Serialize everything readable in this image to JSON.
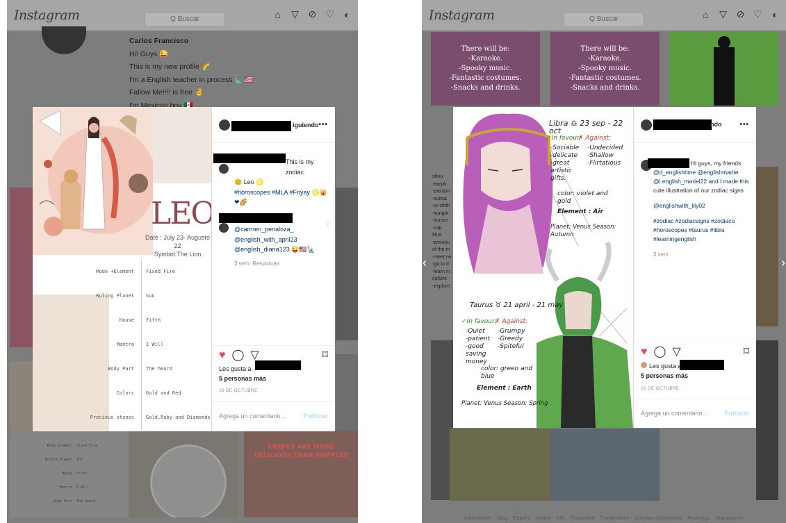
{
  "left": {
    "app": {
      "logo": "Instagram",
      "search_placeholder": "Q Buscar"
    },
    "profile": {
      "name": "Carlos Francisco",
      "bio": [
        "Hi! Guys 😜",
        "This is my new profile 🌈",
        "I'm a English teacher in process 🗽🇺🇸",
        "Fallow Me!!!! is free ✌",
        "I'm Mexican boy 🇲🇽"
      ]
    },
    "image": {
      "title": "LEO",
      "dates": "Date : July 23- Augusto 22",
      "symbol": "Symbol:The Lion",
      "table": [
        {
          "k": "Mode +Element",
          "v": "Fixed Fire"
        },
        {
          "k": "Ruling Planet",
          "v": "Sun"
        },
        {
          "k": "Hause",
          "v": "Fifth"
        },
        {
          "k": "Mantra",
          "v": "I Will"
        },
        {
          "k": "Body Part",
          "v": "The heard"
        },
        {
          "k": "Colors",
          "v": "Gold and Red"
        },
        {
          "k": "Precious stones",
          "v": "Gold,Ruby and Diamonds"
        }
      ]
    },
    "post": {
      "header_following": "iguiendo",
      "caption_tail": "This is my zodiac",
      "caption_line2": "😊 Leo ♌",
      "caption_tags": "#horoscopes #MLA #Friyay ♌🙀❤🌈",
      "caption_time": "3 sem",
      "comment_mentions": [
        "@carmen_penaloza_",
        "@english_with_april23",
        "@english_diana123 😜🇺🇸🗽"
      ],
      "comment_time": "3 sem",
      "reply_label": "Responder",
      "likes_prefix": "Les gusta a",
      "likes_more": "5 personas más",
      "date": "16 DE OCTUBRE",
      "comment_placeholder": "Agrega un comentario...",
      "publish_label": "Publicar"
    },
    "bg_table": [
      {
        "k": "Mode element",
        "v": "Fixed Fire"
      },
      {
        "k": "Ruling Planet",
        "v": "Sun"
      },
      {
        "k": "Hause",
        "v": "Fifth"
      },
      {
        "k": "Mantra",
        "v": "I Will"
      },
      {
        "k": "Body Part",
        "v": "The heard"
      }
    ],
    "bg_tile_text": "CREPES ARE MORE DELICIOUS THAN WAFFLES"
  },
  "right": {
    "app": {
      "logo": "Instagram",
      "search_placeholder": "Q Buscar"
    },
    "bg_tile_lines": [
      "There will be:",
      "-Karaoke.",
      "-Spooky music.",
      "-Fantastic costumes.",
      "-Snacks and drinks."
    ],
    "image": {
      "libra_title": "Libra ♎ 23 sep - 22 oct",
      "libra_favour": "✓In favour:",
      "libra_against": "✗ Against:",
      "libra_favour_items": [
        "-Sociable",
        "-delicate",
        "-great artistic gifts."
      ],
      "libra_against_items": [
        "-Undecided",
        "-Shallow",
        "-Flirtatious"
      ],
      "libra_color": "color: violet and gold",
      "libra_element": "Element : Air",
      "libra_planet": "Planet: Venus  Season: Autumn",
      "taurus_title": "Taurus ♉ 21 april - 21 may",
      "taurus_favour": "✓In favour:",
      "taurus_against": "✗ Against:",
      "taurus_favour_items": [
        "-Quiet",
        "-patient",
        "-good saving money"
      ],
      "taurus_against_items": [
        "-Grumpy",
        "-Greedy",
        "-Spiteful"
      ],
      "taurus_color": "color: green and blue",
      "taurus_element": "Element : Earth",
      "taurus_planet": "Planet: Venus  Season: Spring"
    },
    "post": {
      "header_following": "ndo",
      "caption_greeting": "Hi guys, my friends",
      "caption_lines": [
        "@d_englishtime @englishmarite",
        "@l.english_mariel22 and I made this",
        "cute illustration of our zodiac signs"
      ],
      "caption_mention": "@englishwith_lily02",
      "caption_tags": [
        "#zodiac #zodiacsigns #zodiaco",
        "#horoscopes #taurus #libra",
        "#learningenglish"
      ],
      "caption_time": "3 sem",
      "likes_prefix": "Les gusta a",
      "likes_more": "5 personas más",
      "date": "16 DE OCTUBRE",
      "comment_placeholder": "Agrega un comentario...",
      "publish_label": "Publicar"
    },
    "bg_left_text": [
      "shou",
      "-earph",
      "-passpo",
      "-suitca",
      "-ur cloth",
      "-sungla",
      "-sunscr",
      "-cap",
      "Mus",
      "-previou",
      "of the m",
      "-meet ne",
      "-go to d",
      "-learn m",
      "culture",
      "-explore"
    ],
    "footer": [
      "Información",
      "Blog",
      "Empleo",
      "Ayuda",
      "API",
      "Privacidad",
      "Condiciones",
      "Cuentas destacadas",
      "Hashtags",
      "Ubicaciones"
    ]
  },
  "colors": {
    "like_red": "#ed4956",
    "link_blue": "#00376b",
    "publish_blue": "#b2dffc",
    "leo_title": "#8c4a50"
  }
}
